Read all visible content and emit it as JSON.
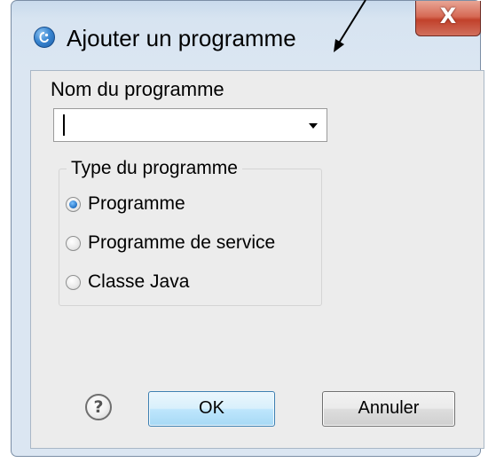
{
  "window": {
    "title": "Ajouter un programme",
    "close_glyph": "X",
    "icon": "app-logo-icon"
  },
  "form": {
    "name_label": "Nom du programme",
    "name_value": "",
    "name_placeholder": "",
    "type_group_label": "Type du programme",
    "type_options": [
      {
        "label": "Programme",
        "checked": true
      },
      {
        "label": "Programme de service",
        "checked": false
      },
      {
        "label": "Classe Java",
        "checked": false
      }
    ]
  },
  "buttons": {
    "help_glyph": "?",
    "ok_label": "OK",
    "cancel_label": "Annuler"
  },
  "icons": {
    "dropdown": "chevron-down-icon",
    "help": "help-icon",
    "annotation": "annotation-arrow-icon"
  },
  "colors": {
    "title_bar": "#d7e4f1",
    "close_button": "#c1412b",
    "ok_button": "#bee6fd",
    "radio_selected": "#1f6fc2"
  }
}
